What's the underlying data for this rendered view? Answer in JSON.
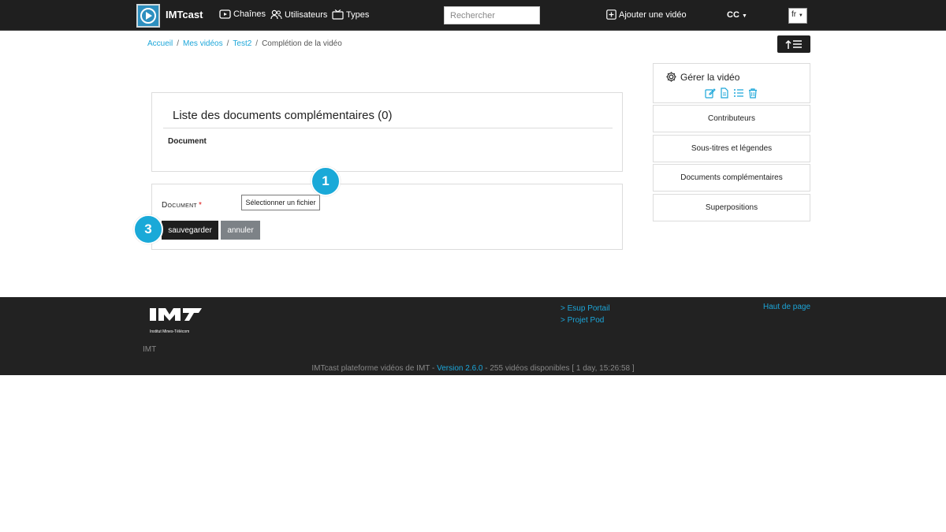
{
  "nav": {
    "brand": "IMTcast",
    "channels": "Chaînes",
    "users": "Utilisateurs",
    "types": "Types",
    "search_placeholder": "Rechercher",
    "add_video": "Ajouter une vidéo",
    "cc": "CC",
    "lang": "fr"
  },
  "breadcrumb": {
    "home": "Accueil",
    "my_videos": "Mes vidéos",
    "video": "Test2",
    "current": "Complétion de la vidéo",
    "separator": "/"
  },
  "list_panel": {
    "title": "Liste des documents complémentaires (0)",
    "column": "Document"
  },
  "form": {
    "label": "Document",
    "required_mark": "*",
    "file_button": "Sélectionner un fichier",
    "save": "sauvegarder",
    "cancel": "annuler"
  },
  "badges": {
    "one": "1",
    "three": "3"
  },
  "sidebar": {
    "title": "Gérer la vidéo",
    "items": [
      "Contributeurs",
      "Sous-titres et légendes",
      "Documents complémentaires",
      "Superpositions"
    ]
  },
  "footer": {
    "links": [
      "> Esup Portail",
      "> Projet Pod"
    ],
    "top_link": "Haut de page",
    "org": "IMT",
    "info_prefix": "IMTcast plateforme vidéos de IMT - ",
    "version": "Version 2.6.0",
    "info_suffix": " - 255 vidéos disponibles [ 1 day, 15:26:58 ]",
    "logo_caption": "Institut Mines-Télécom"
  },
  "colors": {
    "accent": "#1ca6d9",
    "navbar": "#1f1f1f",
    "badge": "#1aa9d8"
  }
}
